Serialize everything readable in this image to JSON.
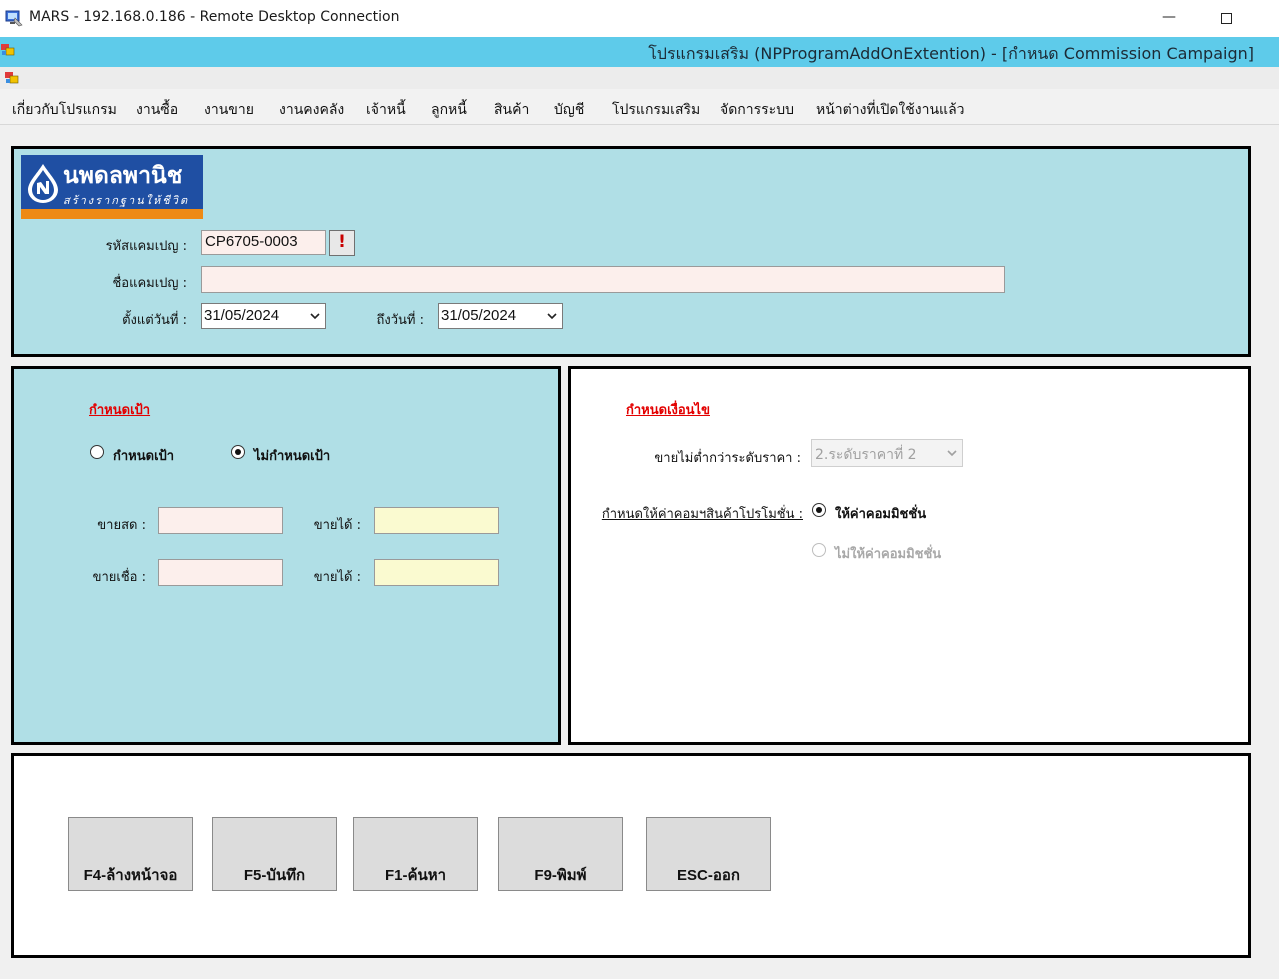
{
  "window": {
    "title": "MARS - 192.168.0.186 - Remote Desktop Connection",
    "minimize_glyph": "—",
    "app_caption": "โปรแกรมเสริม (NPProgramAddOnExtention) - [กำหนด Commission Campaign]"
  },
  "menu": [
    "เกี่ยวกับโปรแกรม",
    "งานซื้อ",
    "งานขาย",
    "งานคงคลัง",
    "เจ้าหนี้",
    "ลูกหนี้",
    "สินค้า",
    "บัญชี",
    "โปรแกรมเสริม",
    "จัดการระบบ",
    "หน้าต่างที่เปิดใช้งานแล้ว"
  ],
  "logo": {
    "name": "นพดลพานิช",
    "slogan": "สร้างรากฐานให้ชีวิต"
  },
  "header": {
    "campaign_code_label": "รหัสแคมเปญ :",
    "campaign_code": "CP6705-0003",
    "alert_glyph": "!",
    "campaign_name_label": "ชื่อแคมเปญ :",
    "campaign_name": "",
    "from_date_label": "ตั้งแต่วันที่ :",
    "from_date": "31/05/2024",
    "to_date_label": "ถึงวันที่ :",
    "to_date": "31/05/2024"
  },
  "target": {
    "title": "กำหนดเป้า",
    "option_set": "กำหนดเป้า",
    "option_none": "ไม่กำหนดเป้า",
    "selected": "none",
    "cash_sale_label": "ขายสด :",
    "credit_sale_label": "ขายเชื่อ :",
    "earn_label_1": "ขายได้ :",
    "earn_label_2": "ขายได้ :",
    "cash_sale_value": "",
    "credit_sale_value": "",
    "earn_value_1": "",
    "earn_value_2": ""
  },
  "condition": {
    "title": "กำหนดเงื่อนไข",
    "min_price_level_label": "ขายไม่ต่ำกว่าระดับราคา :",
    "min_price_level": "2.ระดับราคาที่ 2",
    "promo_commission_label": "กำหนดให้ค่าคอมฯสินค้าโปรโมชั่น :",
    "option_give": "ให้ค่าคอมมิชชั่น",
    "option_no": "ไม่ให้ค่าคอมมิชชั่น",
    "selected": "give"
  },
  "buttons": {
    "clear": "F4-ล้างหน้าจอ",
    "save": "F5-บันทึก",
    "search": "F1-ค้นหา",
    "print": "F9-พิมพ์",
    "exit": "ESC-ออก"
  },
  "colors": {
    "caption_bar": "#5ecbea",
    "panel_bg": "#b0dfe6",
    "section_title": "#e30000",
    "logo_blue": "#1f4fa3",
    "logo_orange": "#ee8a15"
  }
}
